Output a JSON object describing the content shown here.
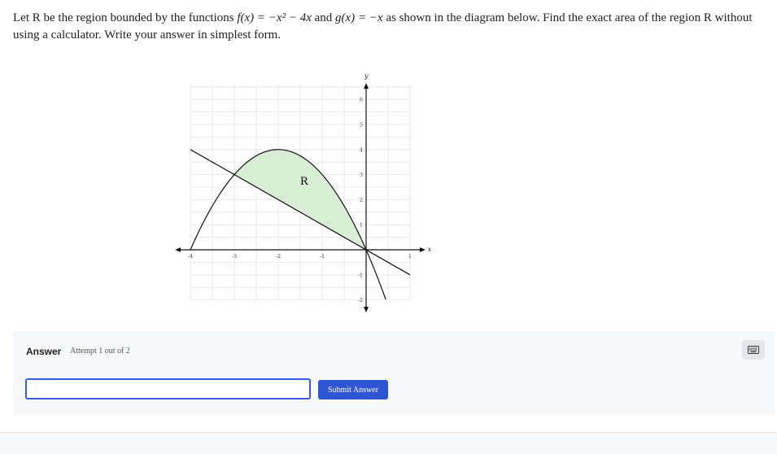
{
  "question": {
    "part1": "Let R be the region bounded by the functions ",
    "f_expr": "f(x) = −x² − 4x",
    "part2": " and ",
    "g_expr": "g(x) = −x",
    "part3": " as shown in the diagram below. Find the exact area of the region R without using a calculator. Write your answer in simplest form."
  },
  "graph": {
    "x_axis_label": "x",
    "y_axis_label": "y",
    "region_label": "R",
    "x_ticks": [
      "-4",
      "-3",
      "-2",
      "-1",
      "1"
    ],
    "y_ticks": [
      "6",
      "5",
      "4",
      "3",
      "2",
      "1",
      "-1",
      "-2"
    ],
    "fill_color": "#d9ecd6"
  },
  "answer": {
    "label": "Answer",
    "attempt": "Attempt 1 out of 2",
    "input_value": "",
    "submit_label": "Submit Answer",
    "accent": "#2f55d4"
  }
}
